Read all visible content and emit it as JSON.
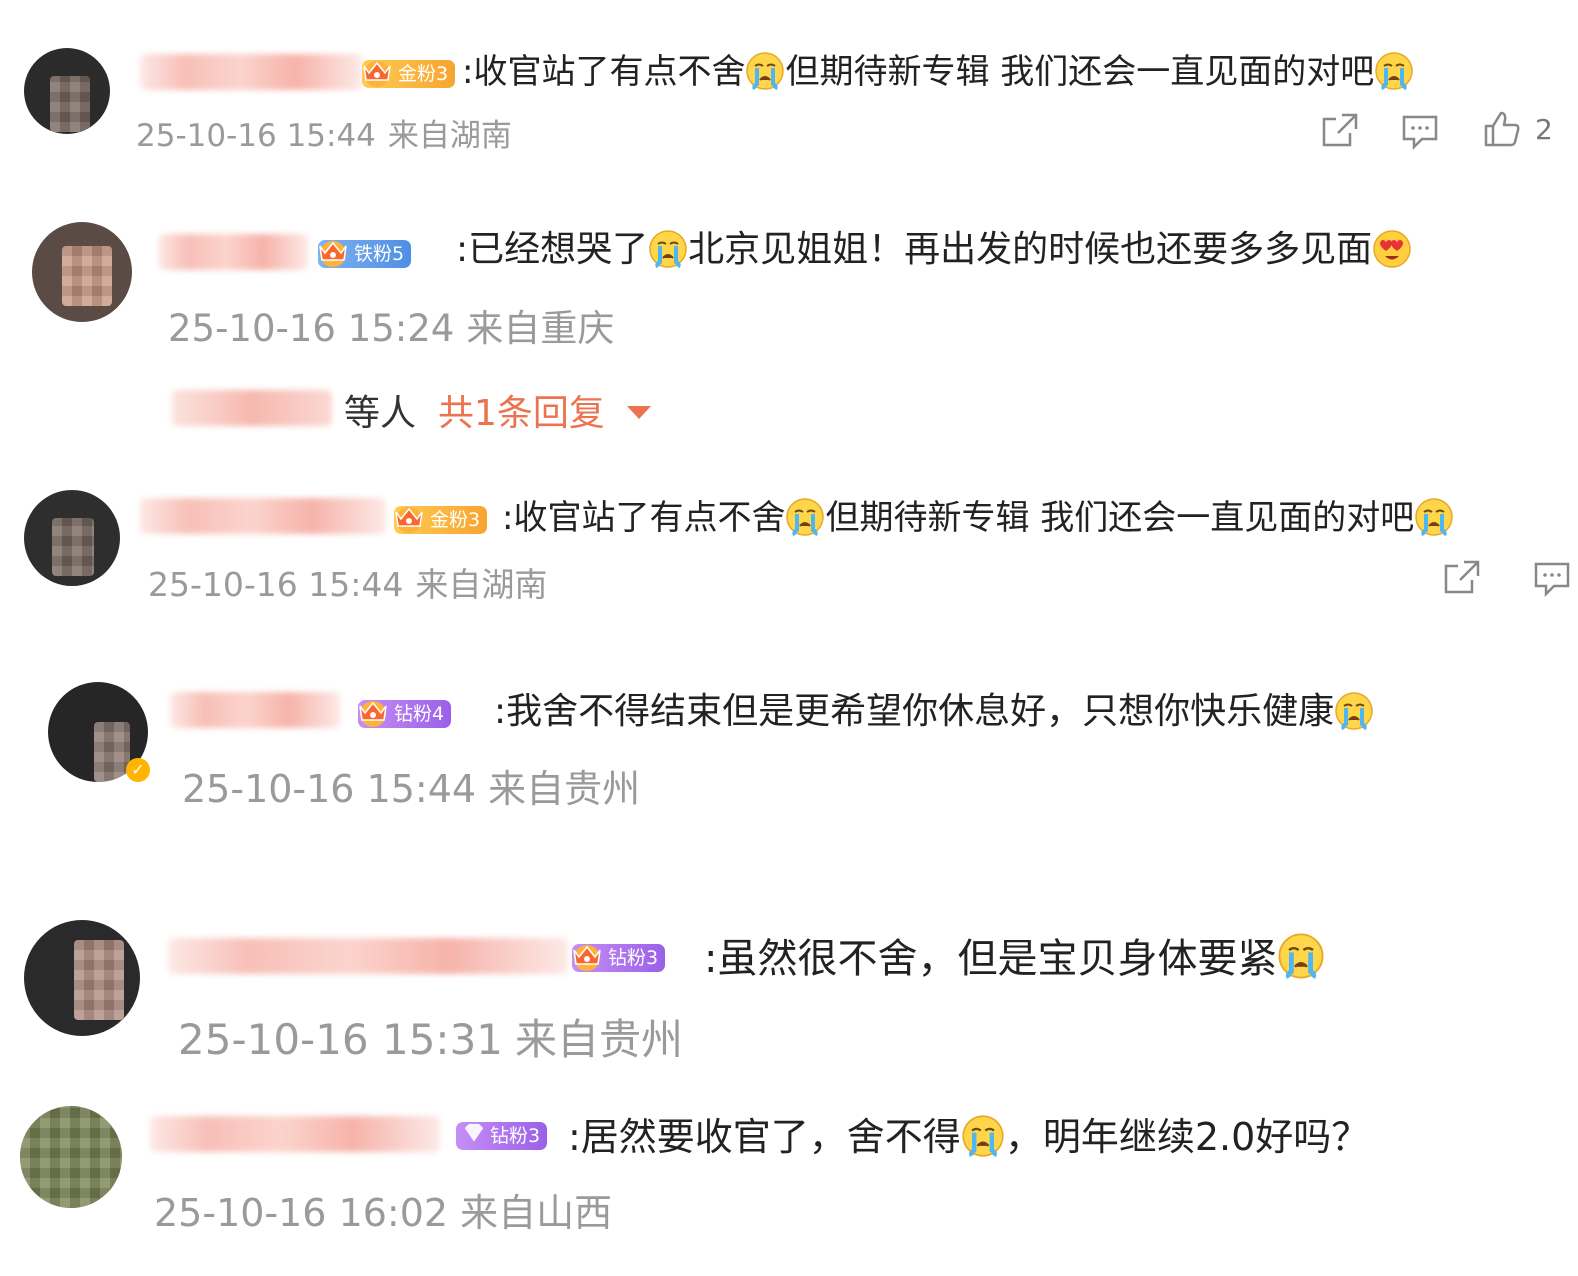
{
  "comments": [
    {
      "badge": "金粉3",
      "text_a": ":收官站了有点不舍",
      "text_b": "但期待新专辑 我们还会一直见面的对吧",
      "date": "25-10-16 15:44",
      "location": "来自湖南",
      "likes": "2"
    },
    {
      "badge": "铁粉5",
      "text_a": ":已经想哭了",
      "text_b": "北京见姐姐！再出发的时候也还要多多见面",
      "date": "25-10-16 15:24",
      "location": "来自重庆",
      "reply_suffix": "等人",
      "reply_count": "共1条回复"
    },
    {
      "badge": "金粉3",
      "text_a": ":收官站了有点不舍",
      "text_b": "但期待新专辑 我们还会一直见面的对吧",
      "date": "25-10-16 15:44",
      "location": "来自湖南"
    },
    {
      "badge": "钻粉4",
      "text_a": ":我舍不得结束但是更希望你休息好，只想你快乐健康",
      "date": "25-10-16 15:44",
      "location": "来自贵州"
    },
    {
      "badge": "钻粉3",
      "text_a": ":虽然很不舍，但是宝贝身体要紧",
      "date": "25-10-16 15:31",
      "location": "来自贵州"
    },
    {
      "badge": "钻粉3",
      "text_a": ":居然要收官了，舍不得",
      "text_b": "，明年继续2.0好吗？",
      "date": "25-10-16 16:02",
      "location": "来自山西"
    }
  ],
  "icons": {
    "share": "share-icon",
    "comment": "comment-icon",
    "like": "like-icon",
    "cry_emoji": "crying-emoji",
    "love_emoji": "heart-eyes-emoji",
    "crown": "crown-icon",
    "verified": "verified-icon"
  },
  "colors": {
    "accent": "#eb7350",
    "meta_text": "#9a9a9a",
    "gold_badge": "#f7a431",
    "iron_badge": "#4e8fe3",
    "diamond_badge": "#9a60e8"
  }
}
